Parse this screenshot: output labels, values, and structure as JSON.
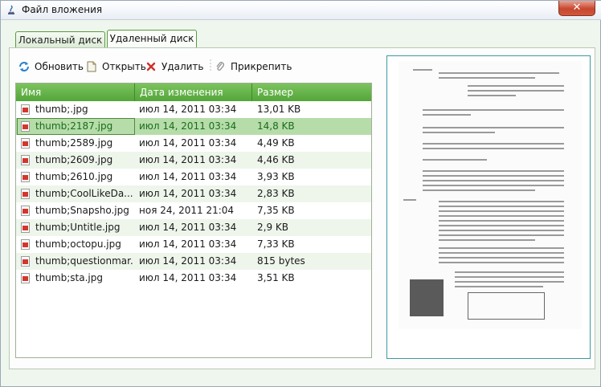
{
  "window": {
    "title": "Файл вложения",
    "close_label": "✕"
  },
  "tabs": [
    {
      "label": "Локальный диск",
      "active": false
    },
    {
      "label": "Удаленный диск",
      "active": true
    }
  ],
  "toolbar": {
    "refresh_label": "Обновить",
    "open_label": "Открыть",
    "delete_label": "Удалить",
    "attach_label": "Прикрепить"
  },
  "table": {
    "columns": {
      "name": "Имя",
      "date": "Дата изменения",
      "size": "Размер"
    },
    "selected_index": 1,
    "rows": [
      {
        "name": "thumb;.jpg",
        "date": "июл 14, 2011 03:34",
        "size": "13,01 KB"
      },
      {
        "name": "thumb;2187.jpg",
        "date": "июл 14, 2011 03:34",
        "size": "14,8 KB"
      },
      {
        "name": "thumb;2589.jpg",
        "date": "июл 14, 2011 03:34",
        "size": "4,49 KB"
      },
      {
        "name": "thumb;2609.jpg",
        "date": "июл 14, 2011 03:34",
        "size": "4,46 KB"
      },
      {
        "name": "thumb;2610.jpg",
        "date": "июл 14, 2011 03:34",
        "size": "3,93 KB"
      },
      {
        "name": "thumb;CoolLikeDa...",
        "date": "июл 14, 2011 03:34",
        "size": "2,83 KB"
      },
      {
        "name": "thumb;Snapsho.jpg",
        "date": "ноя 24, 2011 21:04",
        "size": "7,35 KB"
      },
      {
        "name": "thumb;Untitle.jpg",
        "date": "июл 14, 2011 03:34",
        "size": "2,9 KB"
      },
      {
        "name": "thumb;octopu.jpg",
        "date": "июл 14, 2011 03:34",
        "size": "7,33 KB"
      },
      {
        "name": "thumb;questionmar...",
        "date": "июл 14, 2011 03:34",
        "size": "815 bytes"
      },
      {
        "name": "thumb;sta.jpg",
        "date": "июл 14, 2011 03:34",
        "size": "3,51 KB"
      }
    ]
  },
  "preview": {
    "icon": "document-scan-thumbnail"
  },
  "colors": {
    "header_green": "#53a53a",
    "selected_row": "#b6dcaa",
    "close_red": "#c7472f"
  }
}
